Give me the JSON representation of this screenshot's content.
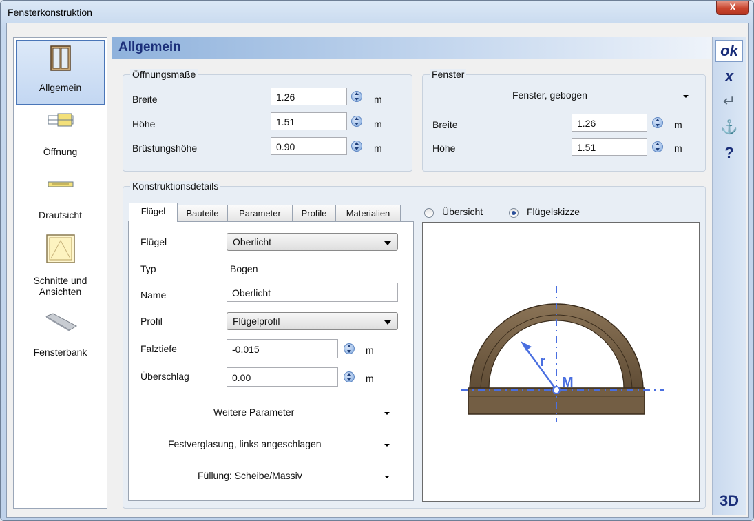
{
  "window": {
    "title": "Fensterkonstruktion",
    "close_glyph": "X"
  },
  "nav": {
    "items": [
      {
        "label": "Allgemein",
        "icon": "window-icon"
      },
      {
        "label": "Öffnung",
        "icon": "opening-icon"
      },
      {
        "label": "Draufsicht",
        "icon": "topview-icon"
      },
      {
        "label": "Schnitte und Ansichten",
        "icon": "section-icon"
      },
      {
        "label": "Fensterbank",
        "icon": "sill-icon"
      }
    ]
  },
  "toolbar": {
    "ok": "ok",
    "cancel": "x",
    "enter": "↵",
    "anchor": "⚓",
    "help": "?",
    "view3d": "3D"
  },
  "header": {
    "title": "Allgemein"
  },
  "oeffnung": {
    "title": "Öffnungsmaße",
    "rows": [
      {
        "label": "Breite",
        "value": "1.26",
        "unit": "m"
      },
      {
        "label": "Höhe",
        "value": "1.51",
        "unit": "m"
      },
      {
        "label": "Brüstungshöhe",
        "value": "0.90",
        "unit": "m"
      }
    ]
  },
  "fenster": {
    "title": "Fenster",
    "type": "Fenster, gebogen",
    "rows": [
      {
        "label": "Breite",
        "value": "1.26",
        "unit": "m"
      },
      {
        "label": "Höhe",
        "value": "1.51",
        "unit": "m"
      }
    ]
  },
  "konstruktion": {
    "title": "Konstruktionsdetails",
    "tabs": [
      "Flügel",
      "Bauteile",
      "Parameter",
      "Profile",
      "Materialien"
    ],
    "fluegel_label": "Flügel",
    "fluegel_value": "Oberlicht",
    "typ_label": "Typ",
    "typ_value": "Bogen",
    "name_label": "Name",
    "name_value": "Oberlicht",
    "profil_label": "Profil",
    "profil_value": "Flügelprofil",
    "falztiefe_label": "Falztiefe",
    "falztiefe_value": "-0.015",
    "falztiefe_unit": "m",
    "ueberschlag_label": "Überschlag",
    "ueberschlag_value": "0.00",
    "ueberschlag_unit": "m",
    "expanders": [
      "Weitere Parameter",
      "Festverglasung, links angeschlagen",
      "Füllung: Scheibe/Massiv"
    ]
  },
  "preview": {
    "radio_overview": "Übersicht",
    "radio_sketch": "Flügelskizze",
    "sketch_radius_label": "r",
    "sketch_center_label": "M"
  }
}
